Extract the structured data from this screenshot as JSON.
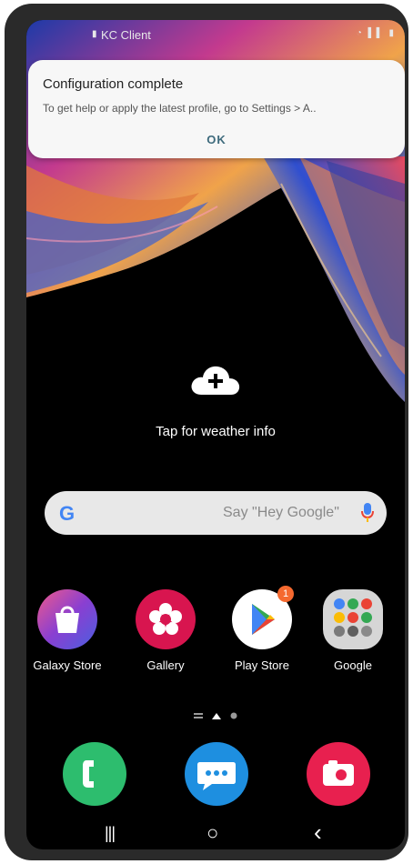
{
  "status_bar": {
    "carrier_label": "KC Client"
  },
  "notification": {
    "title": "Configuration complete",
    "body": "To get help or apply the latest profile, go to Settings > A..",
    "action_label": "OK"
  },
  "weather": {
    "label": "Tap for weather info"
  },
  "search": {
    "logo": "G",
    "placeholder": "Say \"Hey Google\""
  },
  "apps": [
    {
      "label": "Galaxy Store",
      "icon": "galaxy-store-icon"
    },
    {
      "label": "Gallery",
      "icon": "gallery-icon"
    },
    {
      "label": "Play Store",
      "icon": "play-store-icon",
      "badge": "1"
    },
    {
      "label": "Google",
      "icon": "google-folder-icon"
    }
  ],
  "dock": [
    {
      "icon": "phone-icon"
    },
    {
      "icon": "messages-icon"
    },
    {
      "icon": "camera-icon"
    }
  ],
  "navbar": {
    "recents": "|||",
    "home": "○",
    "back": "‹"
  }
}
